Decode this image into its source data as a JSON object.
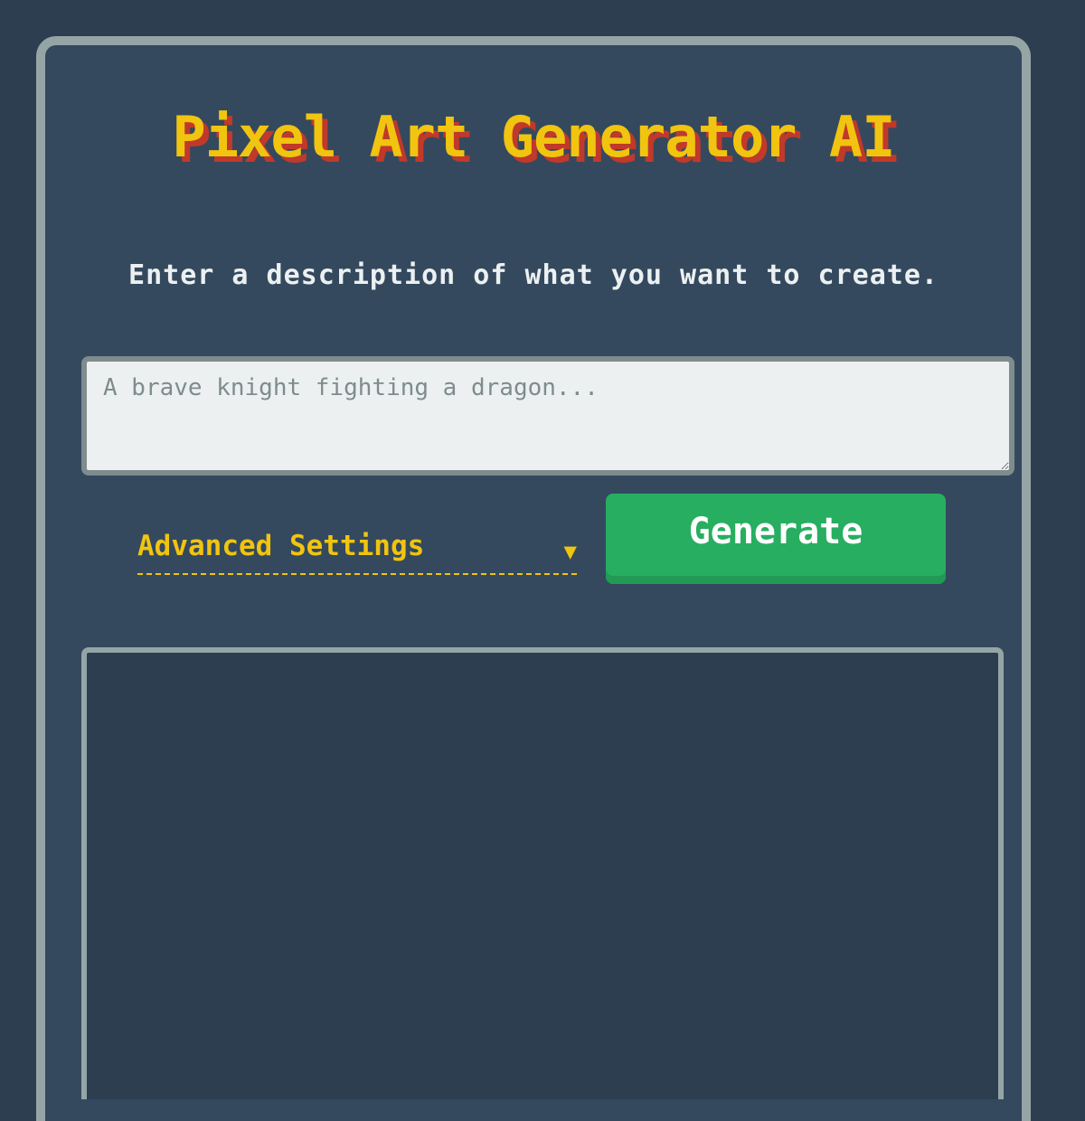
{
  "app": {
    "title": "Pixel Art Generator AI",
    "subtitle": "Enter a description of what you want to create."
  },
  "prompt": {
    "placeholder": "A brave knight fighting a dragon...",
    "value": ""
  },
  "controls": {
    "advanced_label": "Advanced Settings",
    "advanced_caret": "▼",
    "generate_label": "Generate"
  },
  "colors": {
    "background": "#2c3e50",
    "panel": "#34495e",
    "panel_border": "#95a5a6",
    "title": "#f1c40f",
    "title_shadow": "#c0392b",
    "accent": "#f1c40f",
    "button": "#27ae60",
    "text": "#ecf0f1"
  }
}
